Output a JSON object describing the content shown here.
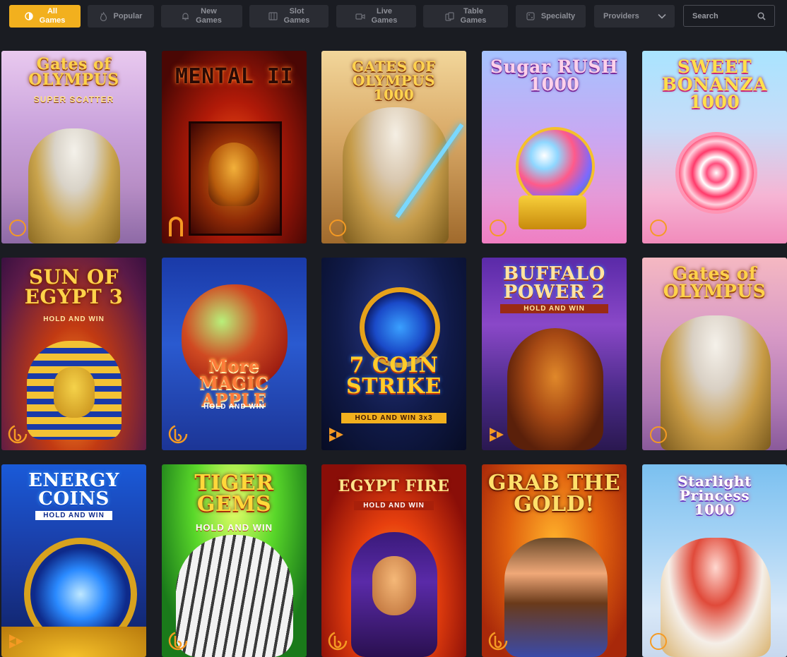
{
  "filters": [
    {
      "label": "All\nGames",
      "icon": "all-games-icon",
      "active": true
    },
    {
      "label": "Popular",
      "icon": "flame-icon",
      "active": false
    },
    {
      "label": "New\nGames",
      "icon": "bell-icon",
      "active": false
    },
    {
      "label": "Slot\nGames",
      "icon": "slot-machine-icon",
      "active": false
    },
    {
      "label": "Live\nGames",
      "icon": "video-camera-icon",
      "active": false
    },
    {
      "label": "Table\nGames",
      "icon": "cards-icon",
      "active": false
    },
    {
      "label": "Specialty",
      "icon": "dice-icon",
      "active": false
    },
    {
      "label": "Providers",
      "icon": "chevron-down-icon",
      "active": false
    }
  ],
  "search": {
    "placeholder": "Search",
    "icon": "search-icon"
  },
  "colors": {
    "accent": "#f2b01e",
    "background": "#1a1c22",
    "pill": "#2a2c33"
  },
  "games": [
    {
      "title": "Gates of\nOLYMPUS",
      "subtitle": "SUPER SCATTER",
      "provider_icon": "pragmatic-provider-icon"
    },
    {
      "title": "MENTAL II",
      "subtitle": "",
      "provider_icon": "nolimit-provider-icon"
    },
    {
      "title": "GATES OF OLYMPUS\n1000",
      "subtitle": "",
      "provider_icon": "pragmatic-provider-icon"
    },
    {
      "title": "Sugar RUSH\n1000",
      "subtitle": "",
      "provider_icon": "pragmatic-provider-icon"
    },
    {
      "title": "SWEET\nBONANZA\n1000",
      "subtitle": "",
      "provider_icon": "pragmatic-provider-icon"
    },
    {
      "title": "SUN OF\nEGYPT 3",
      "subtitle": "HOLD AND WIN",
      "provider_icon": "booongo-provider-icon"
    },
    {
      "title": "More\nMAGIC APPLE",
      "subtitle": "HOLD AND WIN",
      "provider_icon": "booongo-provider-icon"
    },
    {
      "title": "7 COIN\nSTRIKE",
      "subtitle": "HOLD AND WIN 3x3",
      "provider_icon": "playson-provider-icon"
    },
    {
      "title": "BUFFALO\nPOWER 2",
      "subtitle": "HOLD AND WIN",
      "provider_icon": "playson-provider-icon"
    },
    {
      "title": "Gates of\nOLYMPUS",
      "subtitle": "",
      "provider_icon": "pragmatic-provider-icon"
    },
    {
      "title": "ENERGY\nCOINS",
      "subtitle": "HOLD AND WIN",
      "provider_icon": "playson-provider-icon"
    },
    {
      "title": "TIGER\nGEMS",
      "subtitle": "HOLD AND WIN",
      "provider_icon": "booongo-provider-icon"
    },
    {
      "title": "EGYPT FIRE",
      "subtitle": "HOLD AND WIN",
      "provider_icon": "booongo-provider-icon"
    },
    {
      "title": "GRAB THE\nGOLD!",
      "subtitle": "",
      "provider_icon": "booongo-provider-icon"
    },
    {
      "title": "Starlight\nPrincess\n1000",
      "subtitle": "",
      "provider_icon": "pragmatic-provider-icon"
    }
  ]
}
